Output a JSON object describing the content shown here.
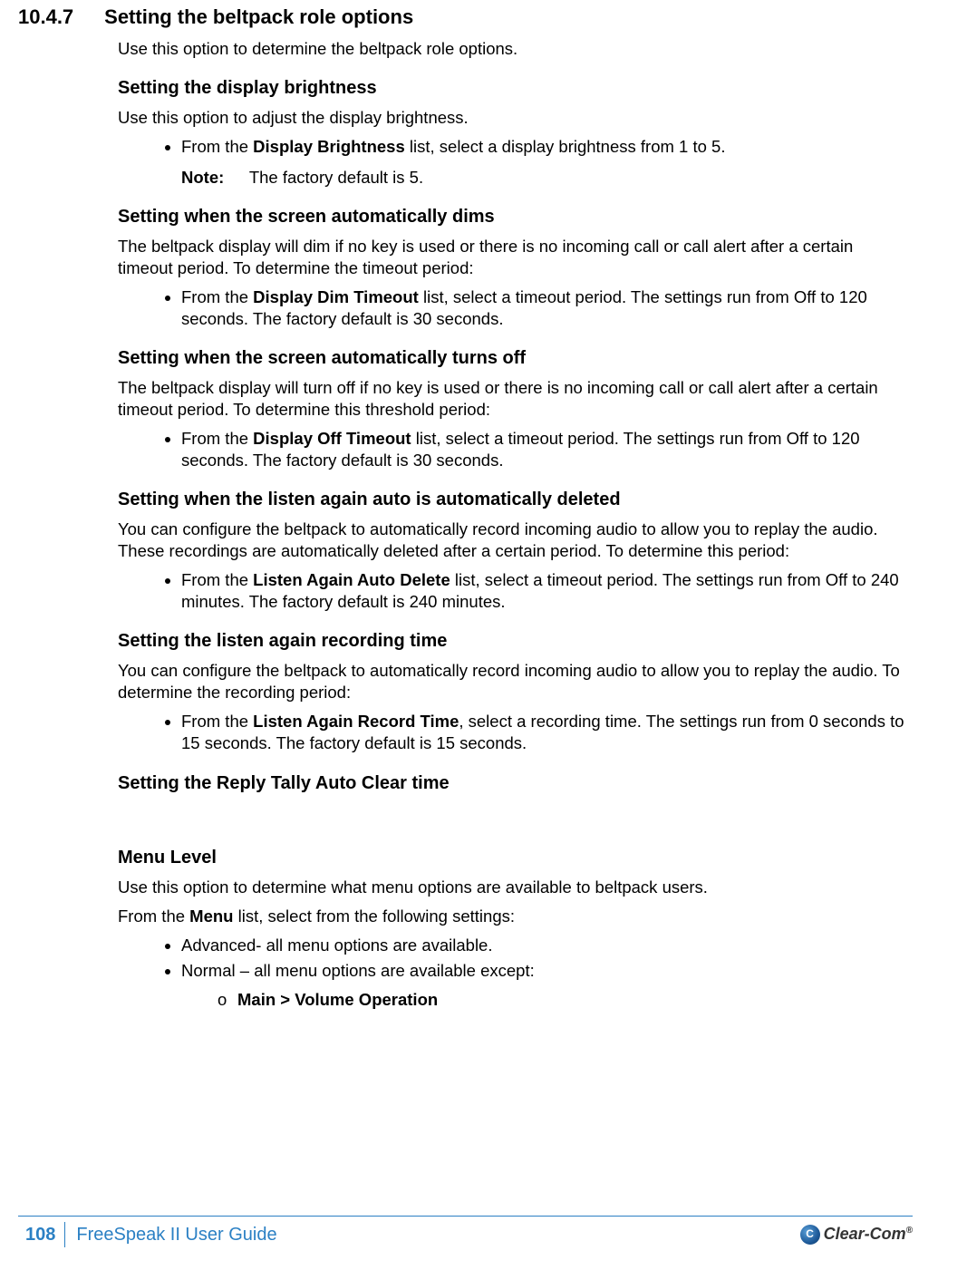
{
  "section": {
    "number": "10.4.7",
    "title": "Setting the beltpack role options",
    "intro": "Use this option to determine the beltpack role options."
  },
  "brightness": {
    "heading": "Setting the display brightness",
    "intro": "Use this option to adjust the display brightness.",
    "bullet_pre": "From the ",
    "bullet_bold": "Display Brightness",
    "bullet_post": " list, select a display brightness from 1 to 5.",
    "note_label": "Note:",
    "note_text": "The factory default is 5."
  },
  "dim": {
    "heading": "Setting when the screen automatically dims",
    "intro": "The beltpack display will dim if no key is used or there is no incoming call or call alert after a certain timeout period. To determine the timeout period:",
    "bullet_pre": "From the ",
    "bullet_bold": "Display Dim Timeout",
    "bullet_post": " list, select a timeout period. The settings run from Off to 120 seconds. The factory default is 30 seconds."
  },
  "off": {
    "heading": "Setting when the screen automatically turns off",
    "intro": "The beltpack display will turn off if no key is used or there is no incoming call or call alert after a certain timeout period. To determine this threshold period:",
    "bullet_pre": "From the ",
    "bullet_bold": "Display Off Timeout",
    "bullet_post": " list, select a timeout period. The settings run from Off to 120 seconds. The factory default is 30 seconds."
  },
  "listen_delete": {
    "heading": "Setting when the listen again auto is automatically deleted",
    "intro": "You can configure the beltpack to automatically record incoming audio to allow you to replay the audio. These recordings are automatically deleted after a certain period. To determine this period:",
    "bullet_pre": "From the ",
    "bullet_bold": "Listen Again Auto Delete",
    "bullet_post": " list, select a timeout period. The settings run from Off to 240 minutes. The factory default is 240 minutes."
  },
  "listen_record": {
    "heading": "Setting the listen again recording time",
    "intro": "You can configure the beltpack to automatically record incoming audio to allow you to replay the audio. To determine the recording period:",
    "bullet_pre": "From the ",
    "bullet_bold": "Listen Again Record Time",
    "bullet_post": ", select a recording time. The settings run from 0 seconds to 15 seconds. The factory default is 15 seconds."
  },
  "reply_tally": {
    "heading": "Setting the Reply Tally Auto Clear time"
  },
  "menu_level": {
    "heading": "Menu Level",
    "intro": "Use this option to determine what menu options are available to beltpack users.",
    "from_pre": "From the ",
    "from_bold": "Menu",
    "from_post": " list, select from the following settings:",
    "opt1": "Advanced- all menu options are available.",
    "opt2": "Normal – all menu options are available except:",
    "sub1": "Main > Volume Operation"
  },
  "footer": {
    "page": "108",
    "guide": "FreeSpeak II User Guide",
    "brand": "Clear-Com",
    "reg": "®"
  }
}
